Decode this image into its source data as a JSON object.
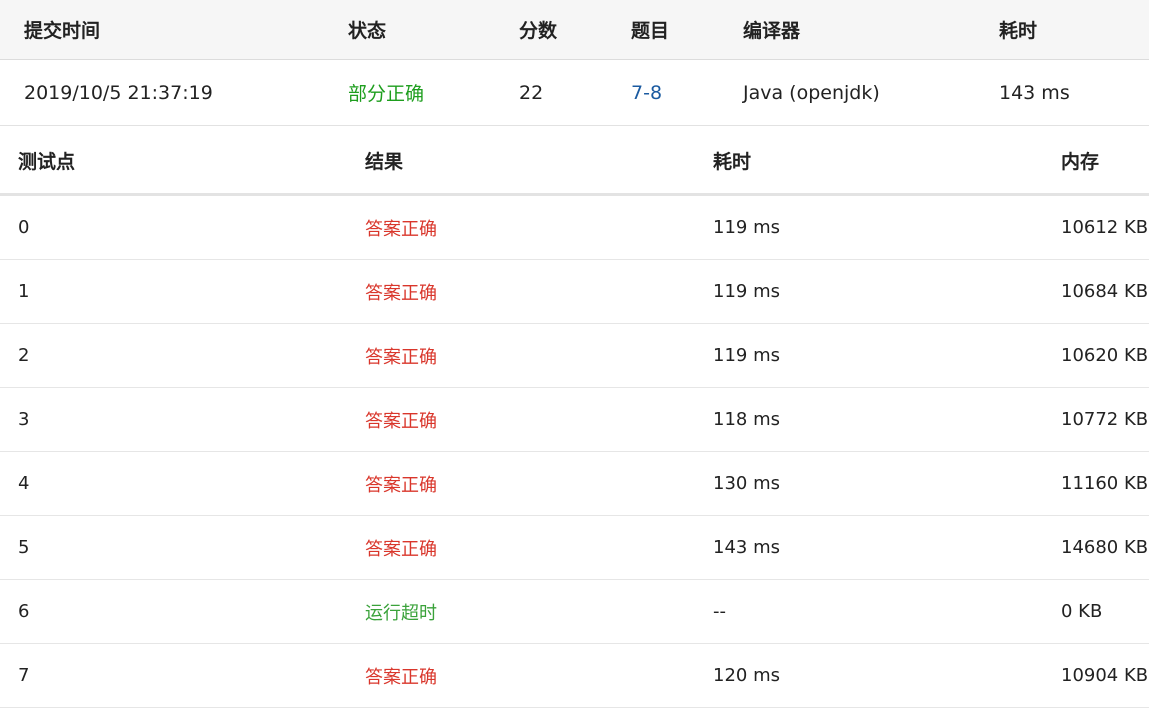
{
  "submission": {
    "headers": {
      "time": "提交时间",
      "status": "状态",
      "score": "分数",
      "problem": "题目",
      "compiler": "编译器",
      "cost": "耗时"
    },
    "row": {
      "time": "2019/10/5 21:37:19",
      "status": "部分正确",
      "score": "22",
      "problem": "7-8",
      "compiler": "Java (openjdk)",
      "cost": "143 ms"
    }
  },
  "cases": {
    "headers": {
      "point": "测试点",
      "result": "结果",
      "time": "耗时",
      "memory": "内存"
    },
    "rows": [
      {
        "point": "0",
        "result": "答案正确",
        "time": "119 ms",
        "memory": "10612 KB",
        "result_color": "#d9362b"
      },
      {
        "point": "1",
        "result": "答案正确",
        "time": "119 ms",
        "memory": "10684 KB",
        "result_color": "#d9362b"
      },
      {
        "point": "2",
        "result": "答案正确",
        "time": "119 ms",
        "memory": "10620 KB",
        "result_color": "#d9362b"
      },
      {
        "point": "3",
        "result": "答案正确",
        "time": "118 ms",
        "memory": "10772 KB",
        "result_color": "#d9362b"
      },
      {
        "point": "4",
        "result": "答案正确",
        "time": "130 ms",
        "memory": "11160 KB",
        "result_color": "#d9362b"
      },
      {
        "point": "5",
        "result": "答案正确",
        "time": "143 ms",
        "memory": "14680 KB",
        "result_color": "#d9362b"
      },
      {
        "point": "6",
        "result": "运行超时",
        "time": "--",
        "memory": "0 KB",
        "result_color": "#3aa23a"
      },
      {
        "point": "7",
        "result": "答案正确",
        "time": "120 ms",
        "memory": "10904 KB",
        "result_color": "#d9362b"
      }
    ]
  },
  "colors": {
    "partial_correct": "#1e9e1e",
    "accepted": "#d9362b",
    "time_limit": "#3aa23a",
    "link": "#1a5aa0"
  }
}
